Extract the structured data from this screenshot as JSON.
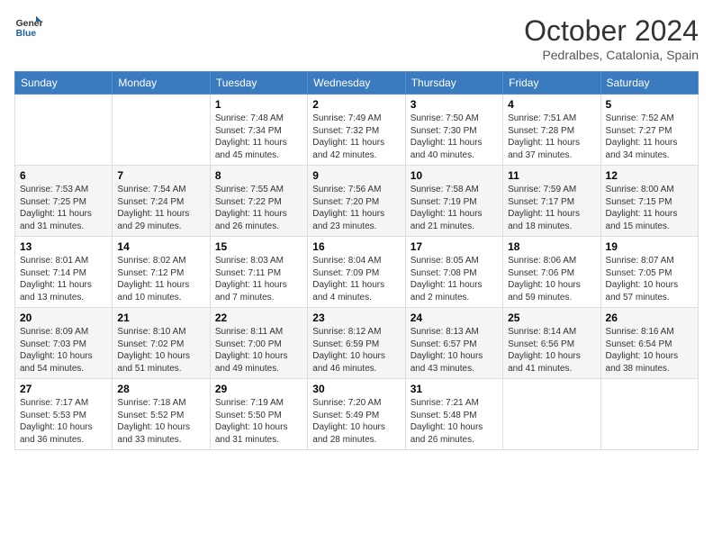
{
  "header": {
    "logo_general": "General",
    "logo_blue": "Blue",
    "month": "October 2024",
    "location": "Pedralbes, Catalonia, Spain"
  },
  "weekdays": [
    "Sunday",
    "Monday",
    "Tuesday",
    "Wednesday",
    "Thursday",
    "Friday",
    "Saturday"
  ],
  "weeks": [
    [
      {
        "day": "",
        "info": ""
      },
      {
        "day": "",
        "info": ""
      },
      {
        "day": "1",
        "info": "Sunrise: 7:48 AM\nSunset: 7:34 PM\nDaylight: 11 hours and 45 minutes."
      },
      {
        "day": "2",
        "info": "Sunrise: 7:49 AM\nSunset: 7:32 PM\nDaylight: 11 hours and 42 minutes."
      },
      {
        "day": "3",
        "info": "Sunrise: 7:50 AM\nSunset: 7:30 PM\nDaylight: 11 hours and 40 minutes."
      },
      {
        "day": "4",
        "info": "Sunrise: 7:51 AM\nSunset: 7:28 PM\nDaylight: 11 hours and 37 minutes."
      },
      {
        "day": "5",
        "info": "Sunrise: 7:52 AM\nSunset: 7:27 PM\nDaylight: 11 hours and 34 minutes."
      }
    ],
    [
      {
        "day": "6",
        "info": "Sunrise: 7:53 AM\nSunset: 7:25 PM\nDaylight: 11 hours and 31 minutes."
      },
      {
        "day": "7",
        "info": "Sunrise: 7:54 AM\nSunset: 7:24 PM\nDaylight: 11 hours and 29 minutes."
      },
      {
        "day": "8",
        "info": "Sunrise: 7:55 AM\nSunset: 7:22 PM\nDaylight: 11 hours and 26 minutes."
      },
      {
        "day": "9",
        "info": "Sunrise: 7:56 AM\nSunset: 7:20 PM\nDaylight: 11 hours and 23 minutes."
      },
      {
        "day": "10",
        "info": "Sunrise: 7:58 AM\nSunset: 7:19 PM\nDaylight: 11 hours and 21 minutes."
      },
      {
        "day": "11",
        "info": "Sunrise: 7:59 AM\nSunset: 7:17 PM\nDaylight: 11 hours and 18 minutes."
      },
      {
        "day": "12",
        "info": "Sunrise: 8:00 AM\nSunset: 7:15 PM\nDaylight: 11 hours and 15 minutes."
      }
    ],
    [
      {
        "day": "13",
        "info": "Sunrise: 8:01 AM\nSunset: 7:14 PM\nDaylight: 11 hours and 13 minutes."
      },
      {
        "day": "14",
        "info": "Sunrise: 8:02 AM\nSunset: 7:12 PM\nDaylight: 11 hours and 10 minutes."
      },
      {
        "day": "15",
        "info": "Sunrise: 8:03 AM\nSunset: 7:11 PM\nDaylight: 11 hours and 7 minutes."
      },
      {
        "day": "16",
        "info": "Sunrise: 8:04 AM\nSunset: 7:09 PM\nDaylight: 11 hours and 4 minutes."
      },
      {
        "day": "17",
        "info": "Sunrise: 8:05 AM\nSunset: 7:08 PM\nDaylight: 11 hours and 2 minutes."
      },
      {
        "day": "18",
        "info": "Sunrise: 8:06 AM\nSunset: 7:06 PM\nDaylight: 10 hours and 59 minutes."
      },
      {
        "day": "19",
        "info": "Sunrise: 8:07 AM\nSunset: 7:05 PM\nDaylight: 10 hours and 57 minutes."
      }
    ],
    [
      {
        "day": "20",
        "info": "Sunrise: 8:09 AM\nSunset: 7:03 PM\nDaylight: 10 hours and 54 minutes."
      },
      {
        "day": "21",
        "info": "Sunrise: 8:10 AM\nSunset: 7:02 PM\nDaylight: 10 hours and 51 minutes."
      },
      {
        "day": "22",
        "info": "Sunrise: 8:11 AM\nSunset: 7:00 PM\nDaylight: 10 hours and 49 minutes."
      },
      {
        "day": "23",
        "info": "Sunrise: 8:12 AM\nSunset: 6:59 PM\nDaylight: 10 hours and 46 minutes."
      },
      {
        "day": "24",
        "info": "Sunrise: 8:13 AM\nSunset: 6:57 PM\nDaylight: 10 hours and 43 minutes."
      },
      {
        "day": "25",
        "info": "Sunrise: 8:14 AM\nSunset: 6:56 PM\nDaylight: 10 hours and 41 minutes."
      },
      {
        "day": "26",
        "info": "Sunrise: 8:16 AM\nSunset: 6:54 PM\nDaylight: 10 hours and 38 minutes."
      }
    ],
    [
      {
        "day": "27",
        "info": "Sunrise: 7:17 AM\nSunset: 5:53 PM\nDaylight: 10 hours and 36 minutes."
      },
      {
        "day": "28",
        "info": "Sunrise: 7:18 AM\nSunset: 5:52 PM\nDaylight: 10 hours and 33 minutes."
      },
      {
        "day": "29",
        "info": "Sunrise: 7:19 AM\nSunset: 5:50 PM\nDaylight: 10 hours and 31 minutes."
      },
      {
        "day": "30",
        "info": "Sunrise: 7:20 AM\nSunset: 5:49 PM\nDaylight: 10 hours and 28 minutes."
      },
      {
        "day": "31",
        "info": "Sunrise: 7:21 AM\nSunset: 5:48 PM\nDaylight: 10 hours and 26 minutes."
      },
      {
        "day": "",
        "info": ""
      },
      {
        "day": "",
        "info": ""
      }
    ]
  ]
}
